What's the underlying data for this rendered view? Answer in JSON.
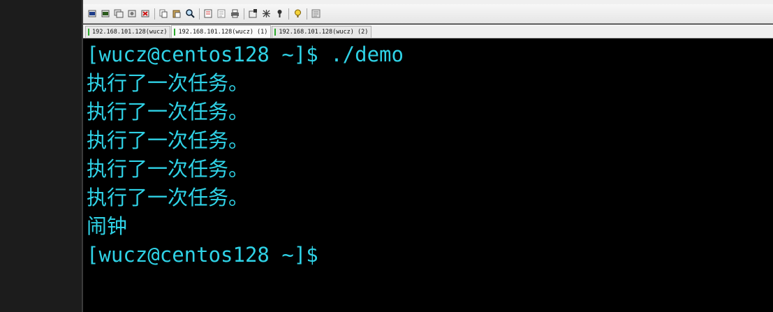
{
  "tabs": [
    {
      "label": "192.168.101.128(wucz)",
      "active": false
    },
    {
      "label": "192.168.101.128(wucz) (1)",
      "active": true
    },
    {
      "label": "192.168.101.128(wucz) (2)",
      "active": false
    }
  ],
  "toolbar": {
    "icons": [
      "new-session-icon",
      "reconnect-icon",
      "duplicate-icon",
      "properties-icon",
      "disconnect-icon",
      "copy-icon",
      "paste-icon",
      "find-icon",
      "print-setup-icon",
      "log-icon",
      "print-icon",
      "settings-icon",
      "keymap-icon",
      "script-icon",
      "help-icon",
      "info-icon"
    ]
  },
  "terminal": {
    "lines": [
      "[wucz@centos128 ~]$ ./demo",
      "执行了一次任务。",
      "执行了一次任务。",
      "执行了一次任务。",
      "执行了一次任务。",
      "执行了一次任务。",
      "闹钟",
      "[wucz@centos128 ~]$"
    ]
  },
  "colors": {
    "terminal_fg": "#2fd2e6",
    "terminal_bg": "#000000",
    "tab_status": "#2eaa2e"
  }
}
